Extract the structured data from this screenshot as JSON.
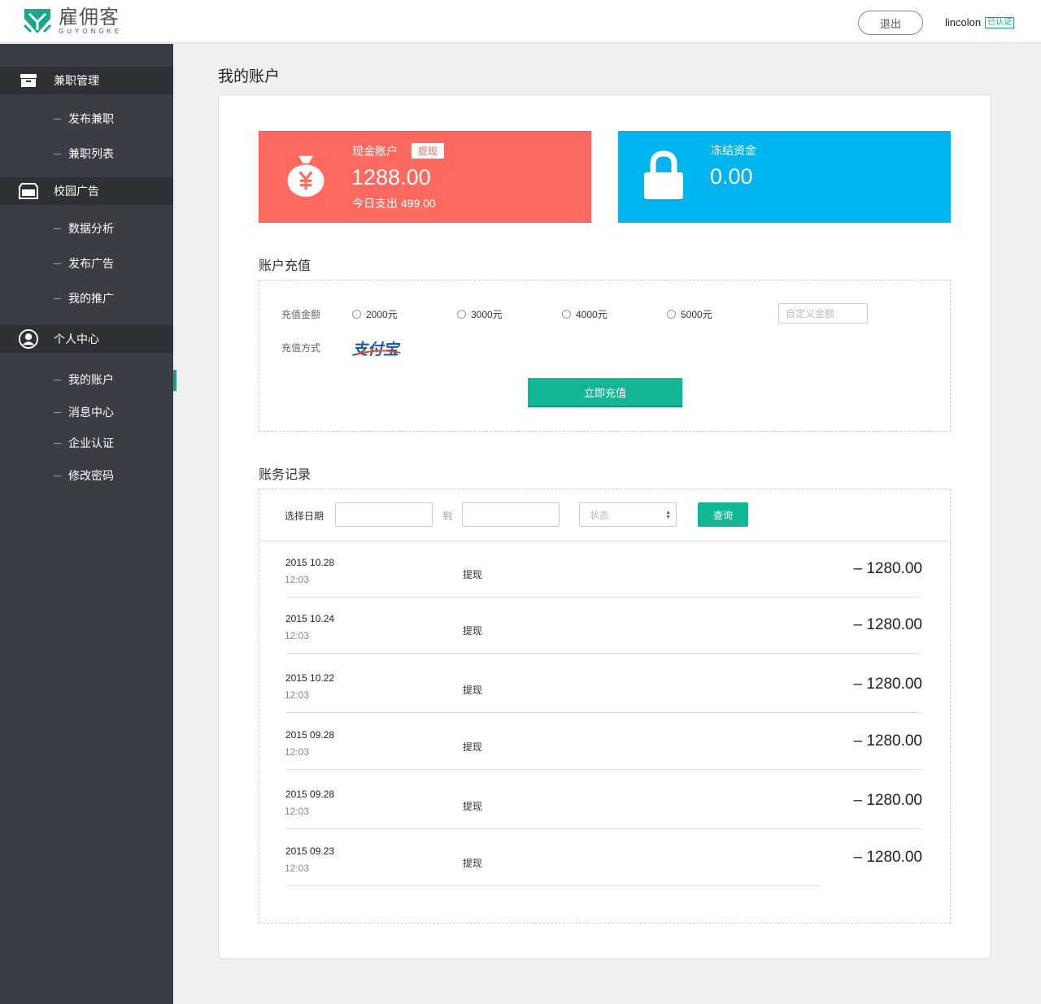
{
  "header": {
    "brand_cn": "雇佣客",
    "brand_en": "GUYONGKE",
    "logout_label": "退出",
    "username": "lincolon",
    "verified_label": "已认证"
  },
  "sidebar": {
    "sections": [
      {
        "label": "兼职管理",
        "icon": "inbox-icon",
        "items": [
          "发布兼职",
          "兼职列表"
        ]
      },
      {
        "label": "校园广告",
        "icon": "folder-icon",
        "items": [
          "数据分析",
          "发布广告",
          "我的推广"
        ]
      },
      {
        "label": "个人中心",
        "icon": "user-icon",
        "items": [
          "我的账户",
          "消息中心",
          "企业认证",
          "修改密码"
        ]
      }
    ],
    "active_item": "我的账户"
  },
  "page": {
    "title": "我的账户"
  },
  "cash_card": {
    "label": "现金账户",
    "tag": "提现",
    "amount": "1288.00",
    "sub": "今日支出 499.00",
    "color": "#fe6960"
  },
  "frozen_card": {
    "label": "冻结资金",
    "amount": "0.00",
    "color": "#00b5ee"
  },
  "recharge": {
    "title": "账户充值",
    "amount_label": "充值金额",
    "options": [
      "2000元",
      "3000元",
      "4000元",
      "5000元"
    ],
    "custom_placeholder": "自定义金额",
    "method_label": "充值方式",
    "method": "支付宝",
    "submit_label": "立即充值"
  },
  "records": {
    "title": "账务记录",
    "date_label": "选择日期",
    "to_label": "到",
    "status_placeholder": "状态",
    "query_label": "查询",
    "rows": [
      {
        "date": "2015 10.28",
        "time": "12:03",
        "type": "提现",
        "amount": "– 1280.00"
      },
      {
        "date": "2015 10.24",
        "time": "12:03",
        "type": "提现",
        "amount": "– 1280.00"
      },
      {
        "date": "2015 10.22",
        "time": "12:03",
        "type": "提现",
        "amount": "– 1280.00"
      },
      {
        "date": "2015 09.28",
        "time": "12:03",
        "type": "提现",
        "amount": "– 1280.00"
      },
      {
        "date": "2015 09.28",
        "time": "12:03",
        "type": "提现",
        "amount": "– 1280.00"
      },
      {
        "date": "2015 09.23",
        "time": "12:03",
        "type": "提现",
        "amount": "– 1280.00"
      }
    ]
  },
  "colors": {
    "accent": "#13b795",
    "sidebar_bg": "#3a3d43",
    "sidebar_section_bg": "#2d3035"
  }
}
